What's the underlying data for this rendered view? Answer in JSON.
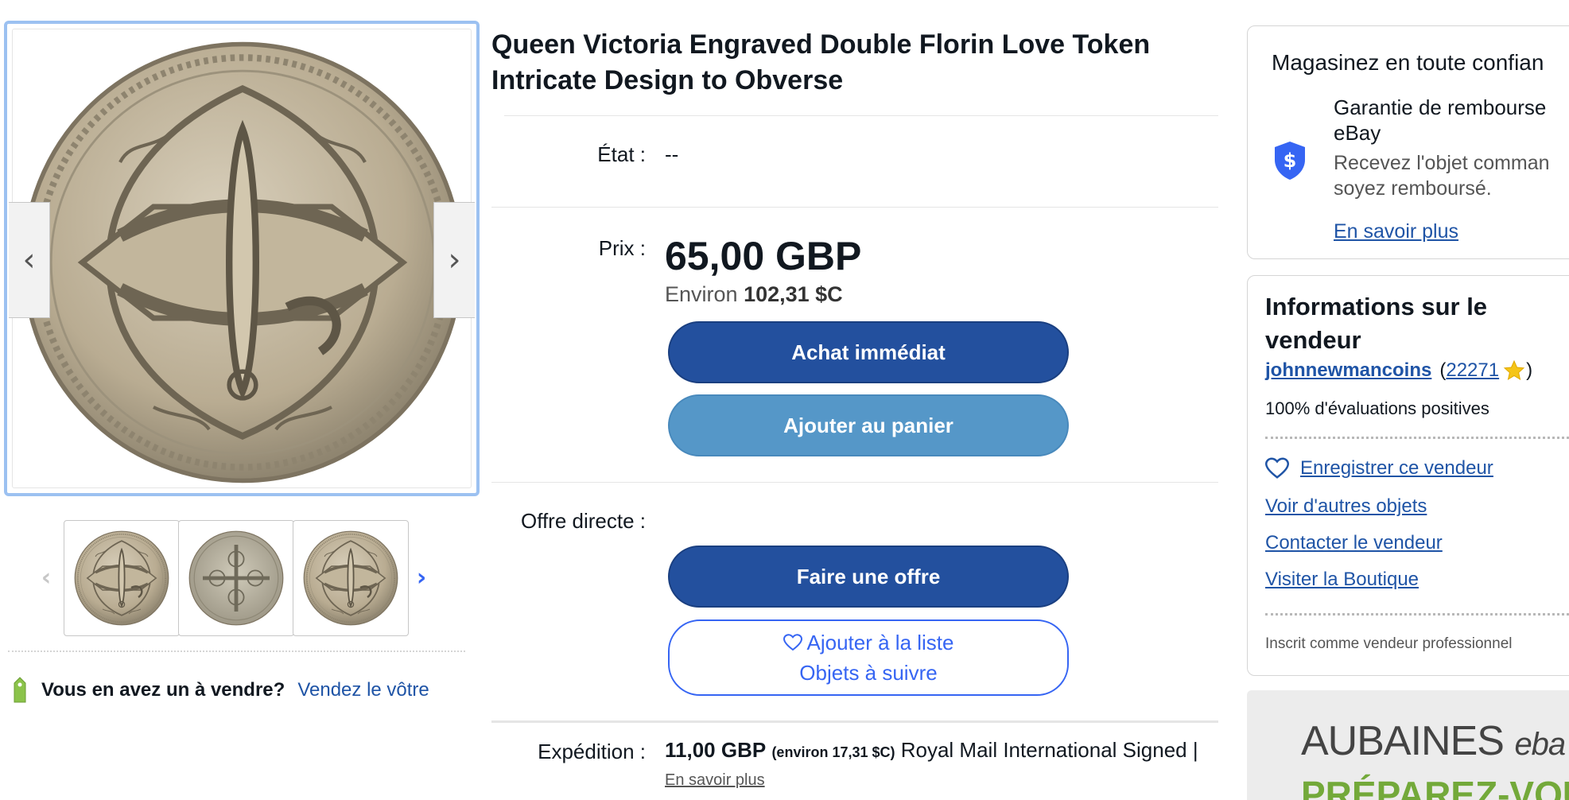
{
  "gallery": {
    "prev_glyph": "‹",
    "next_glyph": "›",
    "thumb_prev_glyph": "‹",
    "thumb_next_glyph": "›",
    "thumbnails": [
      "coin-obverse-engraved",
      "coin-reverse",
      "coin-obverse-engraved"
    ]
  },
  "sell": {
    "question": "Vous en avez un à vendre?",
    "link": "Vendez le vôtre"
  },
  "listing": {
    "title": "Queen Victoria Engraved Double Florin Love Token Intricate Design to Obverse",
    "condition_label": "État :",
    "condition_value": "--",
    "price_label": "Prix :",
    "price": "65,00 GBP",
    "approx_prefix": "Environ",
    "approx_value": "102,31 $C",
    "buy_now": "Achat immédiat",
    "add_to_cart": "Ajouter au panier",
    "best_offer_label": "Offre directe :",
    "make_offer": "Faire une offre",
    "watch_line1": "Ajouter à la liste",
    "watch_line2": "Objets à suivre",
    "shipping_label": "Expédition :",
    "shipping_price": "11,00 GBP",
    "shipping_approx": "(environ 17,31 $C)",
    "shipping_service": "Royal Mail International Signed |",
    "shipping_more": "En savoir plus"
  },
  "trust": {
    "title": "Magasinez en toute confian",
    "heading": "Garantie de rembourse eBay",
    "description": "Recevez l'objet comman soyez remboursé.",
    "link": "En savoir plus"
  },
  "seller": {
    "title": "Informations sur le vendeur",
    "name": "johnnewmancoins",
    "open_paren": "(",
    "score": "22271",
    "close_paren": ")",
    "positive": "100% d'évaluations positives",
    "save": "Enregistrer ce vendeur",
    "other_items": "Voir d'autres objets",
    "contact": "Contacter le vendeur",
    "store": "Visiter la Boutique",
    "business": "Inscrit comme vendeur professionnel"
  },
  "ad": {
    "line1": "AUBAINES",
    "line1_brand": "eba",
    "line2": "PRÉPAREZ-VOUS"
  },
  "colors": {
    "primary_button": "#23509e",
    "secondary_button": "#5597c8",
    "link": "#1f54a6",
    "accent_blue": "#3665f3",
    "tag_green": "#8bc34a"
  },
  "icons": {
    "trust": "shield-dollar-icon",
    "save": "heart-icon",
    "watch": "heart-icon",
    "star": "star-icon",
    "sell": "price-tag-icon"
  }
}
